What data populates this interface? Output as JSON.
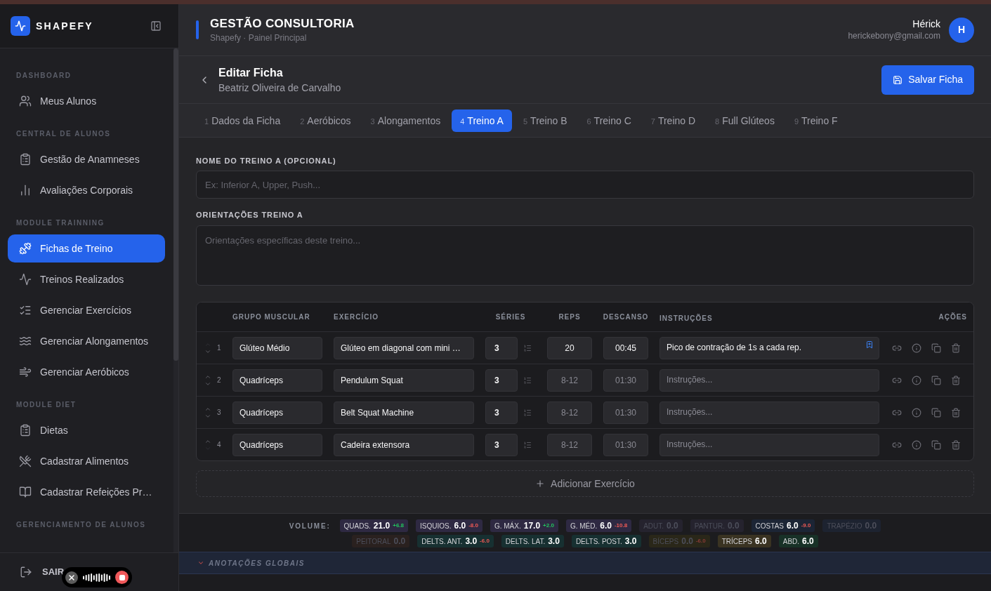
{
  "sidebar": {
    "brand": "SHAPEFY",
    "sections": [
      {
        "title": "DASHBOARD",
        "items": [
          {
            "label": "Meus Alunos",
            "selected": false
          }
        ]
      },
      {
        "title": "CENTRAL DE ALUNOS",
        "items": [
          {
            "label": "Gestão de Anamneses",
            "selected": false
          },
          {
            "label": "Avaliações Corporais",
            "selected": false
          }
        ]
      },
      {
        "title": "MODULE TRAINNING",
        "items": [
          {
            "label": "Fichas de Treino",
            "selected": true
          },
          {
            "label": "Treinos Realizados",
            "selected": false
          },
          {
            "label": "Gerenciar Exercícios",
            "selected": false
          },
          {
            "label": "Gerenciar Alongamentos",
            "selected": false
          },
          {
            "label": "Gerenciar Aeróbicos",
            "selected": false
          }
        ]
      },
      {
        "title": "MODULE DIET",
        "items": [
          {
            "label": "Dietas",
            "selected": false
          },
          {
            "label": "Cadastrar Alimentos",
            "selected": false
          },
          {
            "label": "Cadastrar Refeições Pr…",
            "selected": false
          }
        ]
      },
      {
        "title": "GERENCIAMENTO DE ALUNOS"
      }
    ],
    "logout": "SAIR"
  },
  "header": {
    "title": "GESTÃO CONSULTORIA",
    "subtitle": "Shapefy · Painel Principal",
    "user": {
      "name": "Hérick",
      "email": "herickebony@gmail.com",
      "initial": "H"
    }
  },
  "editor": {
    "title": "Editar Ficha",
    "subtitle": "Beatriz Oliveira de Carvalho",
    "save_button": "Salvar Ficha"
  },
  "tabs": [
    {
      "number": "1",
      "label": "Dados da Ficha",
      "selected": false
    },
    {
      "number": "2",
      "label": "Aeróbicos",
      "selected": false
    },
    {
      "number": "3",
      "label": "Alongamentos",
      "selected": false
    },
    {
      "number": "4",
      "label": "Treino A",
      "selected": true
    },
    {
      "number": "5",
      "label": "Treino B",
      "selected": false
    },
    {
      "number": "6",
      "label": "Treino C",
      "selected": false
    },
    {
      "number": "7",
      "label": "Treino D",
      "selected": false
    },
    {
      "number": "8",
      "label": "Full Glúteos",
      "selected": false
    },
    {
      "number": "9",
      "label": "Treino F",
      "selected": false
    }
  ],
  "form": {
    "name_field": {
      "label": "NOME DO TREINO A (OPCIONAL)",
      "placeholder": "Ex: Inferior A, Upper, Push..."
    },
    "notes_field": {
      "label": "ORIENTAÇÕES TREINO A",
      "placeholder": "Orientações específicas deste treino..."
    }
  },
  "table": {
    "columns": [
      "GRUPO MUSCULAR",
      "EXERCÍCIO",
      "SÉRIES",
      "REPS",
      "DESCANSO",
      "INSTRUÇÕES",
      "AÇÕES"
    ],
    "rows": [
      {
        "number": "1",
        "can_move_up": false,
        "can_move_down": true,
        "muscle_group": "Glúteo Médio",
        "exercise": "Glúteo em diagonal com mini …",
        "sets": "3",
        "reps": {
          "value": "20"
        },
        "rest": {
          "value": "00:45"
        },
        "instructions": {
          "value": "Pico de contração de 1s a cada rep."
        }
      },
      {
        "number": "2",
        "can_move_up": true,
        "can_move_down": true,
        "muscle_group": "Quadríceps",
        "exercise": "Pendulum Squat",
        "sets": "3",
        "reps": {
          "placeholder": "8-12"
        },
        "rest": {
          "placeholder": "01:30"
        },
        "instructions": {
          "placeholder": "Instruções..."
        }
      },
      {
        "number": "3",
        "can_move_up": true,
        "can_move_down": true,
        "muscle_group": "Quadríceps",
        "exercise": "Belt Squat Machine",
        "sets": "3",
        "reps": {
          "placeholder": "8-12"
        },
        "rest": {
          "placeholder": "01:30"
        },
        "instructions": {
          "placeholder": "Instruções..."
        }
      },
      {
        "number": "4",
        "can_move_up": true,
        "can_move_down": false,
        "muscle_group": "Quadríceps",
        "exercise": "Cadeira extensora",
        "sets": "3",
        "reps": {
          "placeholder": "8-12"
        },
        "rest": {
          "placeholder": "01:30"
        },
        "instructions": {
          "placeholder": "Instruções..."
        }
      }
    ],
    "add_button": "Adicionar Exercício"
  },
  "volume": {
    "label": "VOLUME:",
    "rows": [
      {
        "chips": [
          {
            "name": "QUADS.",
            "value": "21.0",
            "delta": "+6.8",
            "increase": true,
            "color": "#2e2942",
            "dimmed": false
          },
          {
            "name": "ISQUIOS.",
            "value": "6.0",
            "delta": "-8.0",
            "increase": false,
            "color": "#2e2942",
            "dimmed": false
          },
          {
            "name": "G. MÁX.",
            "value": "17.0",
            "delta": "+2.0",
            "increase": true,
            "color": "#2e2942",
            "dimmed": false
          },
          {
            "name": "G. MÉD.",
            "value": "6.0",
            "delta": "-10.8",
            "increase": false,
            "color": "#2e2942",
            "dimmed": false
          },
          {
            "name": "ADUT.",
            "value": "0.0",
            "color": "#25232e",
            "dimmed": true
          },
          {
            "name": "PANTUR.",
            "value": "0.0",
            "color": "#25232e",
            "dimmed": true
          },
          {
            "name": "COSTAS",
            "value": "6.0",
            "delta": "-9.0",
            "increase": false,
            "color": "#1c2535",
            "dimmed": false
          },
          {
            "name": "TRAPÉZIO",
            "value": "0.0",
            "color": "#1d2330",
            "dimmed": true
          }
        ]
      },
      {
        "chips": [
          {
            "name": "PEITORAL",
            "value": "0.0",
            "color": "#2a211f",
            "dimmed": true
          },
          {
            "name": "DELTS. ANT.",
            "value": "3.0",
            "delta": "-6.0",
            "increase": false,
            "color": "#173031",
            "dimmed": false
          },
          {
            "name": "DELTS. LAT.",
            "value": "3.0",
            "color": "#173031",
            "dimmed": false
          },
          {
            "name": "DELTS. POST.",
            "value": "3.0",
            "color": "#173031",
            "dimmed": false
          },
          {
            "name": "BÍCEPS",
            "value": "0.0",
            "delta": "-6.0",
            "increase": false,
            "color": "#2a2719",
            "dimmed": true
          },
          {
            "name": "TRÍCEPS",
            "value": "6.0",
            "color": "#3a3322",
            "dimmed": false
          },
          {
            "name": "ABD.",
            "value": "6.0",
            "color": "#183127",
            "dimmed": false
          }
        ]
      }
    ]
  },
  "annotations": {
    "title": "ANOTAÇÕES GLOBAIS",
    "expanded": false
  }
}
